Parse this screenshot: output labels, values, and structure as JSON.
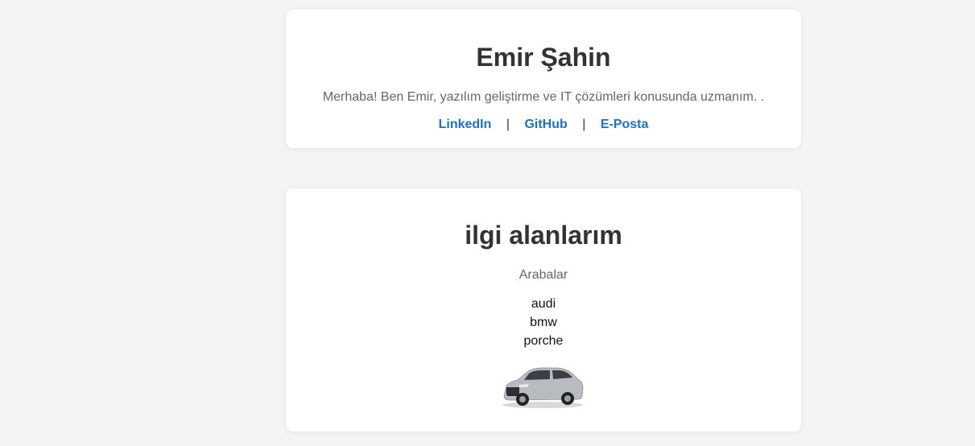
{
  "profile": {
    "name": "Emir Şahin",
    "bio": "Merhaba! Ben Emir, yazılım geliştirme ve IT çözümleri konusunda uzmanım. .",
    "links": [
      {
        "label": "LinkedIn"
      },
      {
        "label": "GitHub"
      },
      {
        "label": "E-Posta"
      }
    ],
    "separator": "|"
  },
  "interests": {
    "title": "ilgi alanlarım",
    "subtitle": "Arabalar",
    "cars": [
      "audi",
      "bmw",
      "porche"
    ]
  },
  "colors": {
    "page_background": "#f4f4f4",
    "card_background": "#ffffff",
    "link": "#1a73c9",
    "heading": "#333333",
    "muted_text": "#666666"
  }
}
